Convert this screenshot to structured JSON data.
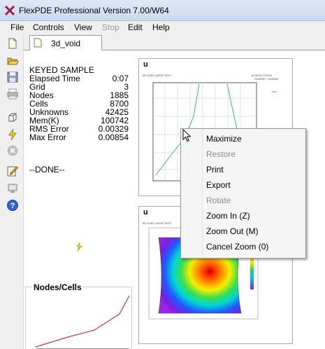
{
  "window": {
    "title": "FlexPDE Professional Version 7.00/W64"
  },
  "menu": [
    {
      "label": "File",
      "enabled": true
    },
    {
      "label": "Controls",
      "enabled": true
    },
    {
      "label": "View",
      "enabled": true
    },
    {
      "label": "Stop",
      "enabled": false
    },
    {
      "label": "Edit",
      "enabled": true
    },
    {
      "label": "Help",
      "enabled": true
    }
  ],
  "tab": {
    "label": "3d_void"
  },
  "stats": {
    "title": "KEYED SAMPLE",
    "rows": [
      {
        "label": "Elapsed Time",
        "value": "0:07"
      },
      {
        "label": "Grid",
        "value": "3"
      },
      {
        "label": "Nodes",
        "value": "1885"
      },
      {
        "label": "Cells",
        "value": "8700"
      },
      {
        "label": "Unknowns",
        "value": "42425"
      },
      {
        "label": "Mem(K)",
        "value": "100742"
      },
      {
        "label": "RMS Error",
        "value": "0.00329"
      },
      {
        "label": "Max Error",
        "value": "0.00854"
      }
    ],
    "done": "--DONE--"
  },
  "nodes_panel": {
    "title": "Nodes/Cells"
  },
  "plots": {
    "top": {
      "label": "u",
      "header": "3D VOID LAYER TEST",
      "stamp": "10:35:44 7/13/16",
      "version": "FlexPDE 7.00/W64"
    },
    "bottom": {
      "label": "u",
      "header": "3D VOID LAYER TEST"
    }
  },
  "context_menu": [
    {
      "label": "Maximize",
      "enabled": true
    },
    {
      "label": "Restore",
      "enabled": false
    },
    {
      "label": "Print",
      "enabled": true
    },
    {
      "label": "Export",
      "enabled": true
    },
    {
      "label": "Rotate",
      "enabled": false
    },
    {
      "label": "Zoom In (Z)",
      "enabled": true
    },
    {
      "label": "Zoom Out (M)",
      "enabled": true
    },
    {
      "label": "Cancel Zoom (0)",
      "enabled": true
    }
  ],
  "colors": {
    "accent_red": "#d01010",
    "line_green": "#2cc06a",
    "title_bar": "#dfe9f5"
  }
}
